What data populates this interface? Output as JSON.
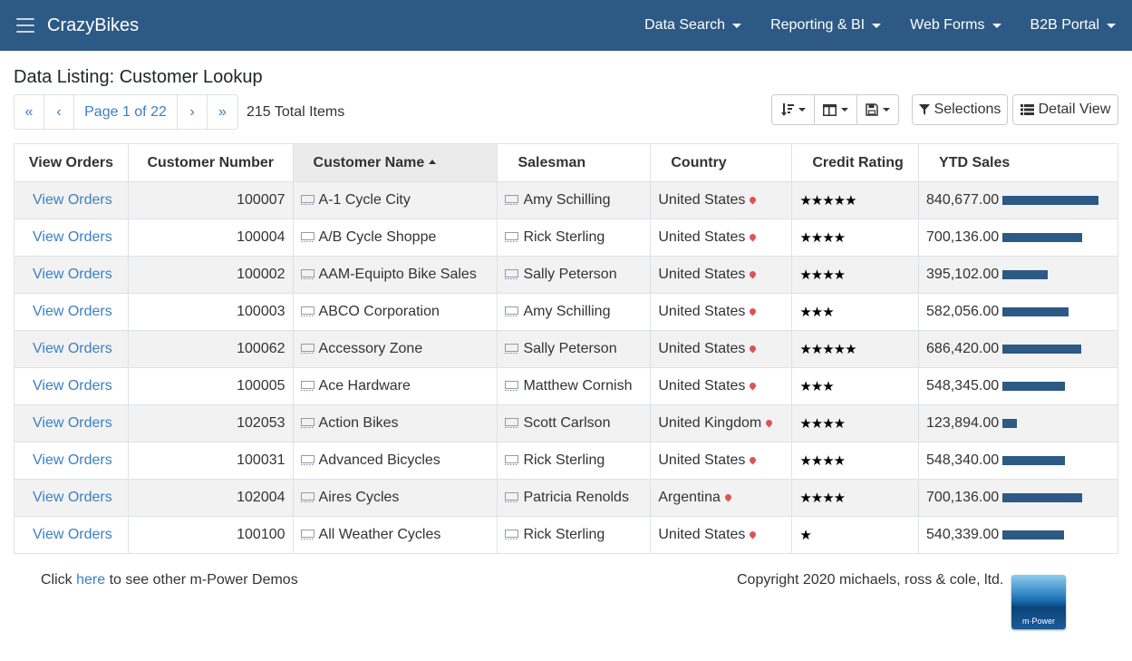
{
  "navbar": {
    "brand": "CrazyBikes",
    "items": [
      {
        "label": "Data Search"
      },
      {
        "label": "Reporting & BI"
      },
      {
        "label": "Web Forms"
      },
      {
        "label": "B2B Portal"
      }
    ]
  },
  "page": {
    "title": "Data Listing: Customer Lookup"
  },
  "pagination": {
    "first": "«",
    "prev": "‹",
    "page_label": "Page 1 of 22",
    "next": "›",
    "last": "»",
    "total": "215 Total Items"
  },
  "toolbar": {
    "selections_label": "Selections",
    "detail_view_label": "Detail View"
  },
  "table": {
    "columns": [
      "View Orders",
      "Customer Number",
      "Customer Name",
      "Salesman",
      "Country",
      "Credit Rating",
      "YTD Sales"
    ],
    "rows": [
      {
        "view": "View Orders",
        "number": "100007",
        "name": "A-1 Cycle City",
        "salesman": "Amy Schilling",
        "country": "United States",
        "rating": 5,
        "ytd": "840,677.00",
        "ytd_value": 840677
      },
      {
        "view": "View Orders",
        "number": "100004",
        "name": "A/B Cycle Shoppe",
        "salesman": "Rick Sterling",
        "country": "United States",
        "rating": 4,
        "ytd": "700,136.00",
        "ytd_value": 700136
      },
      {
        "view": "View Orders",
        "number": "100002",
        "name": "AAM-Equipto Bike Sales",
        "salesman": "Sally Peterson",
        "country": "United States",
        "rating": 4,
        "ytd": "395,102.00",
        "ytd_value": 395102
      },
      {
        "view": "View Orders",
        "number": "100003",
        "name": "ABCO Corporation",
        "salesman": "Amy Schilling",
        "country": "United States",
        "rating": 3,
        "ytd": "582,056.00",
        "ytd_value": 582056
      },
      {
        "view": "View Orders",
        "number": "100062",
        "name": "Accessory Zone",
        "salesman": "Sally Peterson",
        "country": "United States",
        "rating": 5,
        "ytd": "686,420.00",
        "ytd_value": 686420
      },
      {
        "view": "View Orders",
        "number": "100005",
        "name": "Ace Hardware",
        "salesman": "Matthew Cornish",
        "country": "United States",
        "rating": 3,
        "ytd": "548,345.00",
        "ytd_value": 548345
      },
      {
        "view": "View Orders",
        "number": "102053",
        "name": "Action Bikes",
        "salesman": "Scott Carlson",
        "country": "United Kingdom",
        "rating": 4,
        "ytd": "123,894.00",
        "ytd_value": 123894
      },
      {
        "view": "View Orders",
        "number": "100031",
        "name": "Advanced Bicycles",
        "salesman": "Rick Sterling",
        "country": "United States",
        "rating": 4,
        "ytd": "548,340.00",
        "ytd_value": 548340
      },
      {
        "view": "View Orders",
        "number": "102004",
        "name": "Aires Cycles",
        "salesman": "Patricia Renolds",
        "country": "Argentina",
        "rating": 4,
        "ytd": "700,136.00",
        "ytd_value": 700136
      },
      {
        "view": "View Orders",
        "number": "100100",
        "name": "All Weather Cycles",
        "salesman": "Rick Sterling",
        "country": "United States",
        "rating": 1,
        "ytd": "540,339.00",
        "ytd_value": 540339
      }
    ]
  },
  "footer": {
    "click": "Click",
    "here": "here",
    "rest": "to see other m-Power Demos",
    "copyright": "Copyright 2020 michaels, ross & cole, ltd.",
    "logo_text": "m·Power"
  },
  "colors": {
    "navbar": "#2d5985",
    "link": "#3b7fc4",
    "bar": "#2d5985",
    "pin": "#e05252"
  }
}
